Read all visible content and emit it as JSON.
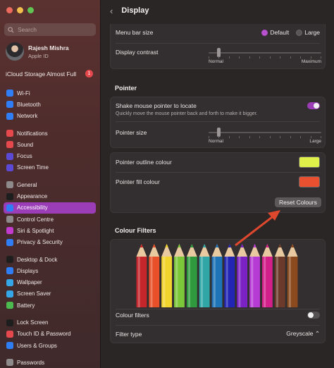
{
  "window": {
    "traffic_lights": [
      "#ec6a5e",
      "#f4be4f",
      "#61c554"
    ]
  },
  "sidebar": {
    "search_placeholder": "Search",
    "user": {
      "name": "Rajesh Mishra",
      "subtitle": "Apple ID"
    },
    "icloud": {
      "label": "iCloud Storage Almost Full",
      "badge": "1"
    },
    "groups": [
      [
        {
          "label": "Wi-Fi",
          "icon": "wifi-icon",
          "color": "#2f7ef5"
        },
        {
          "label": "Bluetooth",
          "icon": "bluetooth-icon",
          "color": "#2f7ef5"
        },
        {
          "label": "Network",
          "icon": "network-icon",
          "color": "#2f7ef5"
        }
      ],
      [
        {
          "label": "Notifications",
          "icon": "notifications-icon",
          "color": "#e5484d"
        },
        {
          "label": "Sound",
          "icon": "sound-icon",
          "color": "#e5484d"
        },
        {
          "label": "Focus",
          "icon": "focus-icon",
          "color": "#5b4ad6"
        },
        {
          "label": "Screen Time",
          "icon": "screen-time-icon",
          "color": "#5b4ad6"
        }
      ],
      [
        {
          "label": "General",
          "icon": "general-icon",
          "color": "#8e8a8b"
        },
        {
          "label": "Appearance",
          "icon": "appearance-icon",
          "color": "#1e1e1e"
        },
        {
          "label": "Accessibility",
          "icon": "accessibility-icon",
          "color": "#2f7ef5",
          "active": true
        },
        {
          "label": "Control Centre",
          "icon": "control-centre-icon",
          "color": "#8e8a8b"
        },
        {
          "label": "Siri & Spotlight",
          "icon": "siri-icon",
          "color": "#c43bd0"
        },
        {
          "label": "Privacy & Security",
          "icon": "privacy-icon",
          "color": "#2f7ef5"
        }
      ],
      [
        {
          "label": "Desktop & Dock",
          "icon": "desktop-dock-icon",
          "color": "#1e1e1e"
        },
        {
          "label": "Displays",
          "icon": "displays-icon",
          "color": "#2f7ef5"
        },
        {
          "label": "Wallpaper",
          "icon": "wallpaper-icon",
          "color": "#35a7e8"
        },
        {
          "label": "Screen Saver",
          "icon": "screen-saver-icon",
          "color": "#35a7e8"
        },
        {
          "label": "Battery",
          "icon": "battery-icon",
          "color": "#4cba4f"
        }
      ],
      [
        {
          "label": "Lock Screen",
          "icon": "lock-screen-icon",
          "color": "#1e1e1e"
        },
        {
          "label": "Touch ID & Password",
          "icon": "touch-id-icon",
          "color": "#e5484d"
        },
        {
          "label": "Users & Groups",
          "icon": "users-groups-icon",
          "color": "#2f7ef5"
        }
      ],
      [
        {
          "label": "Passwords",
          "icon": "passwords-icon",
          "color": "#8e8a8b"
        }
      ]
    ]
  },
  "main": {
    "title": "Display",
    "menu_bar_size": {
      "label": "Menu bar size",
      "options": [
        "Default",
        "Large"
      ],
      "selected": "Default"
    },
    "display_contrast": {
      "label": "Display contrast",
      "min_label": "Normal",
      "max_label": "Maximum",
      "value": 0.0
    },
    "pointer": {
      "heading": "Pointer",
      "shake_label": "Shake mouse pointer to locate",
      "shake_desc": "Quickly move the mouse pointer back and forth to make it bigger.",
      "shake_on": true,
      "size_label": "Pointer size",
      "size_min_label": "Normal",
      "size_max_label": "Large",
      "size_value": 0.0,
      "outline_label": "Pointer outline colour",
      "outline_color": "#dff04a",
      "fill_label": "Pointer fill colour",
      "fill_color": "#e8502f",
      "reset_label": "Reset Colours"
    },
    "colour_filters": {
      "heading": "Colour Filters",
      "pencil_colors": [
        "#c5262b",
        "#e8502a",
        "#f2d52c",
        "#7cc63a",
        "#2e9a3d",
        "#30a7a6",
        "#1f74b7",
        "#2225b4",
        "#7b22c4",
        "#b63bd4",
        "#d21f89",
        "#6b3a2a",
        "#8a4a1e"
      ],
      "filters_label": "Colour filters",
      "filters_on": false,
      "type_label": "Filter type",
      "type_value": "Greyscale"
    }
  }
}
